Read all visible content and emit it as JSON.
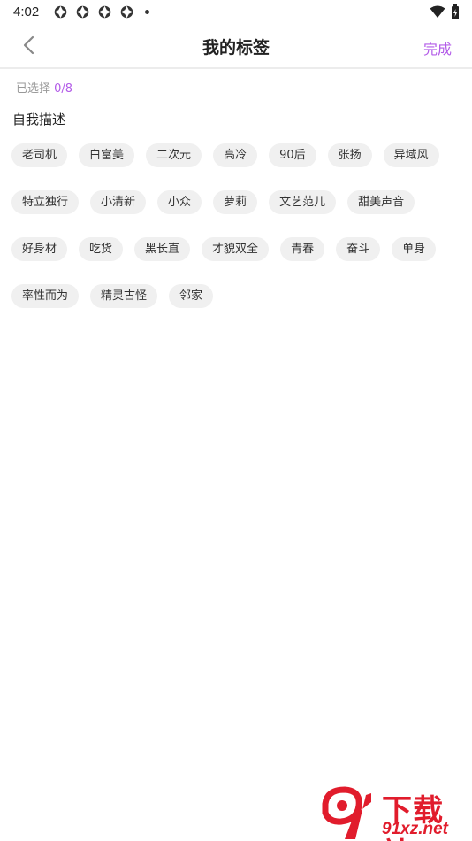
{
  "status_bar": {
    "time": "4:02"
  },
  "header": {
    "title": "我的标签",
    "done_label": "完成"
  },
  "selection": {
    "prefix": "已选择",
    "count": "0/8"
  },
  "section": {
    "title": "自我描述"
  },
  "tags": [
    [
      "老司机",
      "白富美",
      "二次元",
      "高冷",
      "90后",
      "张扬",
      "异域风"
    ],
    [
      "特立独行",
      "小清新",
      "小众",
      "萝莉",
      "文艺范儿",
      "甜美声音"
    ],
    [
      "好身材",
      "吃货",
      "黑长直",
      "才貌双全",
      "青春",
      "奋斗",
      "单身"
    ],
    [
      "率性而为",
      "精灵古怪",
      "邻家"
    ]
  ],
  "watermark": {
    "top": "下载站",
    "bottom": "91xz.net"
  },
  "colors": {
    "accent": "#b35ce8",
    "tag_bg": "#f0f0f0",
    "watermark": "#e11c2c"
  }
}
